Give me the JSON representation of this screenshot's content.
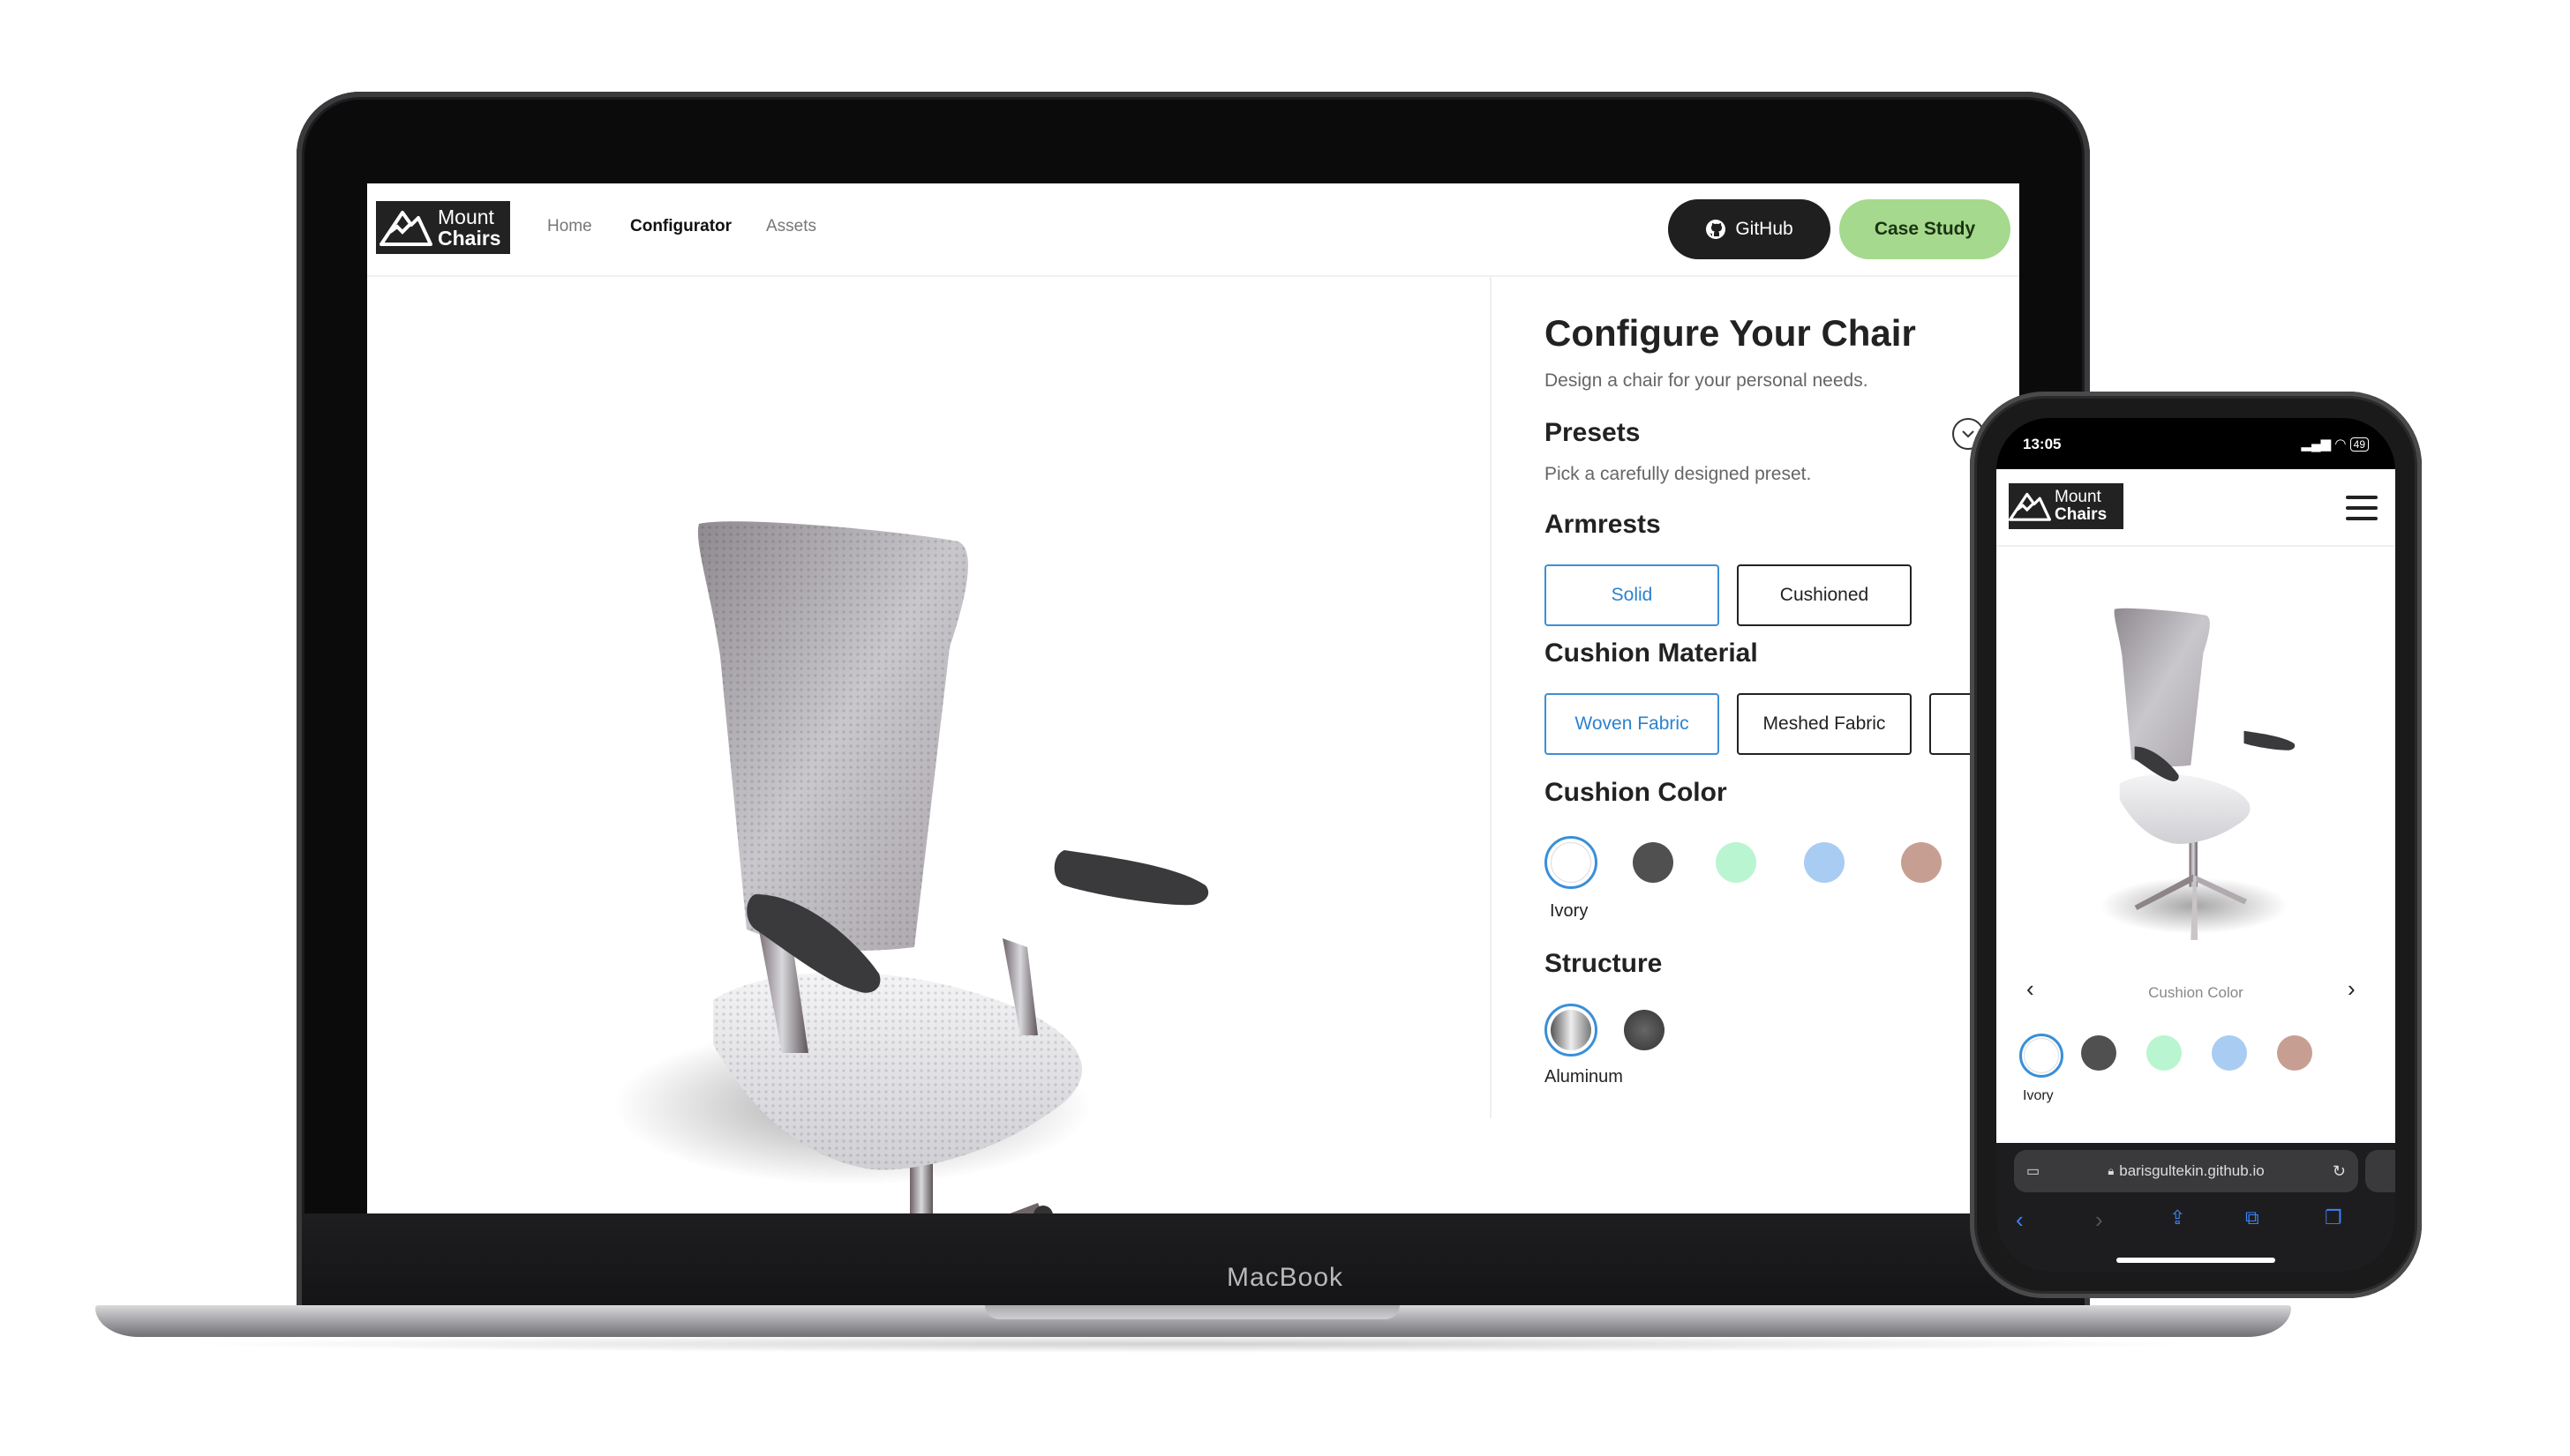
{
  "device_labels": {
    "laptop_brand": "MacBook"
  },
  "desktop": {
    "logo": {
      "line1": "Mount",
      "line2": "Chairs"
    },
    "nav": [
      {
        "label": "Home",
        "active": false
      },
      {
        "label": "Configurator",
        "active": true
      },
      {
        "label": "Assets",
        "active": false
      }
    ],
    "buttons": {
      "github": "GitHub",
      "case_study": "Case Study"
    },
    "panel": {
      "title": "Configure Your Chair",
      "subtitle": "Design a chair for your personal needs.",
      "presets": {
        "heading": "Presets",
        "description": "Pick a carefully designed preset."
      },
      "armrests": {
        "heading": "Armrests",
        "options": [
          "Solid",
          "Cushioned"
        ],
        "selected": "Solid"
      },
      "cushion_material": {
        "heading": "Cushion Material",
        "options": [
          "Woven Fabric",
          "Meshed Fabric"
        ],
        "selected": "Woven Fabric"
      },
      "cushion_color": {
        "heading": "Cushion Color",
        "selected_label": "Ivory",
        "colors": [
          "#ffffff",
          "#505050",
          "#b9f5d0",
          "#a9ccf2",
          "#c79f92"
        ]
      },
      "structure": {
        "heading": "Structure",
        "selected_label": "Aluminum",
        "options": [
          "aluminum",
          "dark-metal"
        ]
      }
    }
  },
  "mobile": {
    "status": {
      "time": "13:05",
      "battery": "49"
    },
    "logo": {
      "line1": "Mount",
      "line2": "Chairs"
    },
    "carousel": {
      "caption": "Cushion Color",
      "prev": "‹",
      "next": "›"
    },
    "selected_label": "Ivory",
    "colors": [
      "#ffffff",
      "#505050",
      "#b9f5d0",
      "#a9ccf2",
      "#c79f92"
    ],
    "url": "barisgultekin.github.io"
  },
  "colors": {
    "accent_blue": "#3a8fd8",
    "case_study_green": "#a5d98e",
    "dark": "#1f1f1f"
  }
}
